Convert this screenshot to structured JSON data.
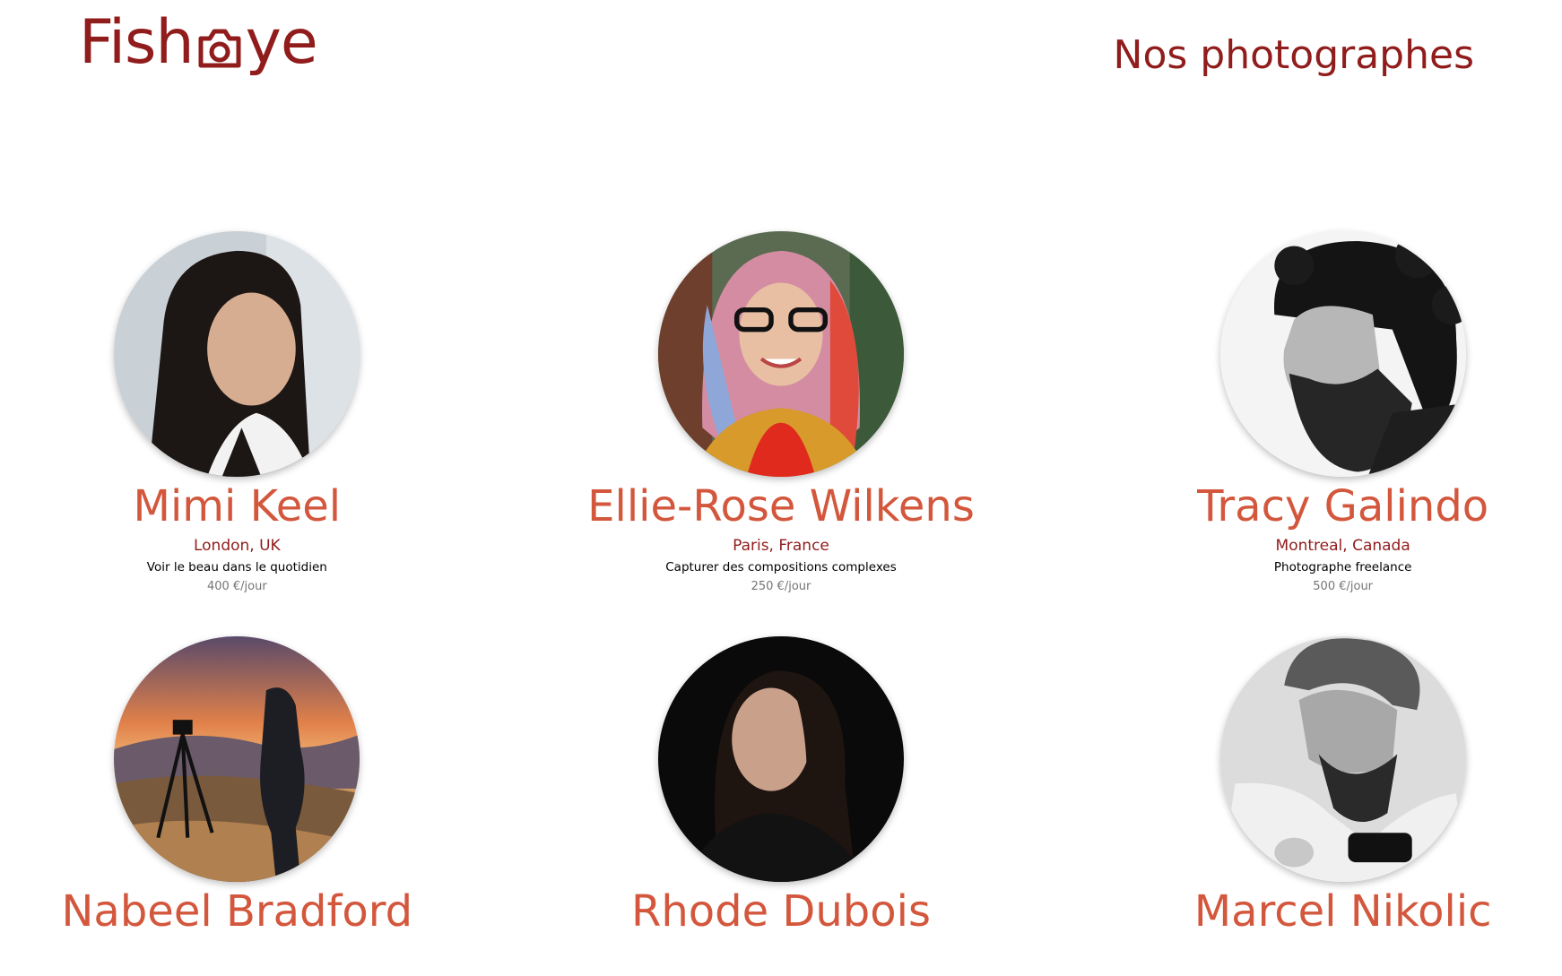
{
  "header": {
    "logo_text_before": "Fish",
    "logo_text_after": "ye",
    "logo_icon": "camera-icon",
    "title": "Nos photographes"
  },
  "colors": {
    "primary": "#901c1c",
    "secondary": "#d3573c",
    "muted": "#757575"
  },
  "photographers": [
    {
      "name": "Mimi Keel",
      "location": "London, UK",
      "tagline": "Voir le beau dans le quotidien",
      "price": "400 €/jour"
    },
    {
      "name": "Ellie-Rose Wilkens",
      "location": "Paris, France",
      "tagline": "Capturer des compositions complexes",
      "price": "250 €/jour"
    },
    {
      "name": "Tracy Galindo",
      "location": "Montreal, Canada",
      "tagline": "Photographe freelance",
      "price": "500 €/jour"
    },
    {
      "name": "Nabeel Bradford"
    },
    {
      "name": "Rhode Dubois"
    },
    {
      "name": "Marcel Nikolic"
    }
  ]
}
